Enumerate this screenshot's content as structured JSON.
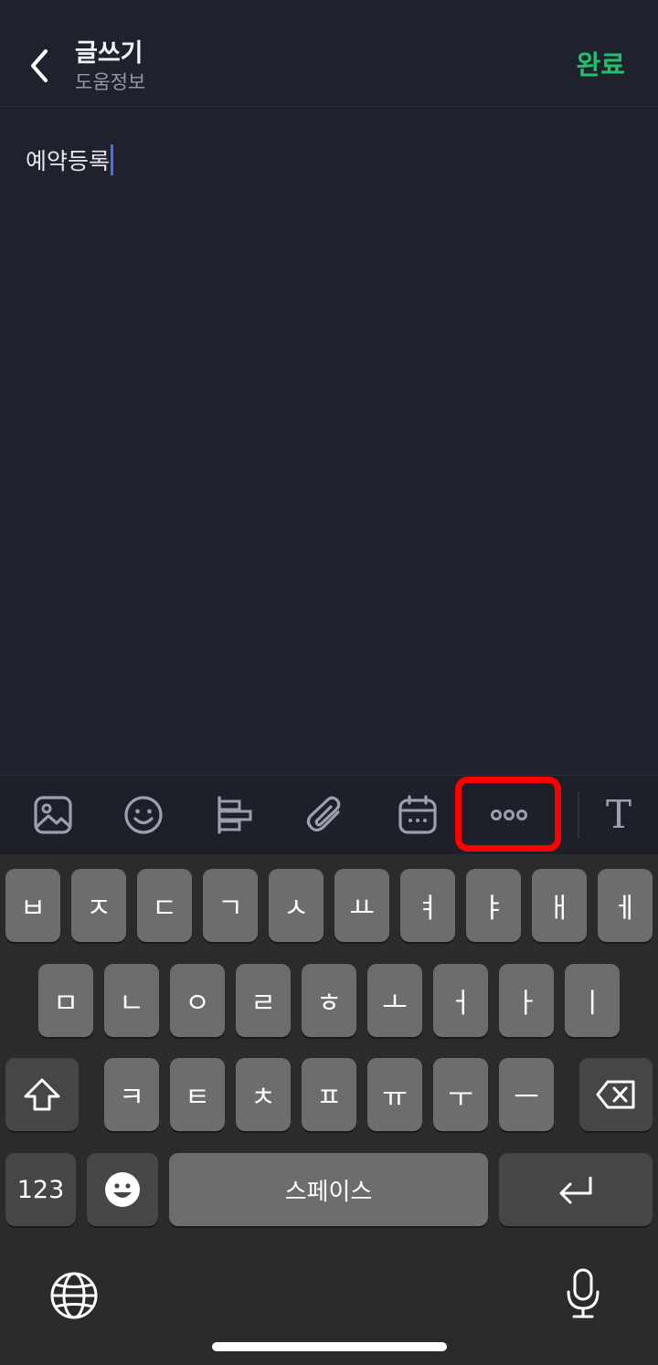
{
  "header": {
    "title": "글쓰기",
    "subtitle": "도움정보",
    "done_label": "완료"
  },
  "editor": {
    "text": "예약등록"
  },
  "toolbar": {
    "items": [
      "image-icon",
      "emoji-icon",
      "align-icon",
      "attachment-icon",
      "calendar-icon",
      "more-icon",
      "text-format-icon"
    ],
    "text_format_label": "T",
    "highlight_color": "#ff0000"
  },
  "keyboard": {
    "row1": [
      "ㅂ",
      "ㅈ",
      "ㄷ",
      "ㄱ",
      "ㅅ",
      "ㅛ",
      "ㅕ",
      "ㅑ",
      "ㅐ",
      "ㅔ"
    ],
    "row2": [
      "ㅁ",
      "ㄴ",
      "ㅇ",
      "ㄹ",
      "ㅎ",
      "ㅗ",
      "ㅓ",
      "ㅏ",
      "ㅣ"
    ],
    "row3": [
      "ㅋ",
      "ㅌ",
      "ㅊ",
      "ㅍ",
      "ㅠ",
      "ㅜ",
      "ㅡ"
    ],
    "numbers_label": "123",
    "space_label": "스페이스"
  },
  "colors": {
    "accent_done": "#1fc26b",
    "caret": "#4a6cf3",
    "background": "#1f222d"
  }
}
